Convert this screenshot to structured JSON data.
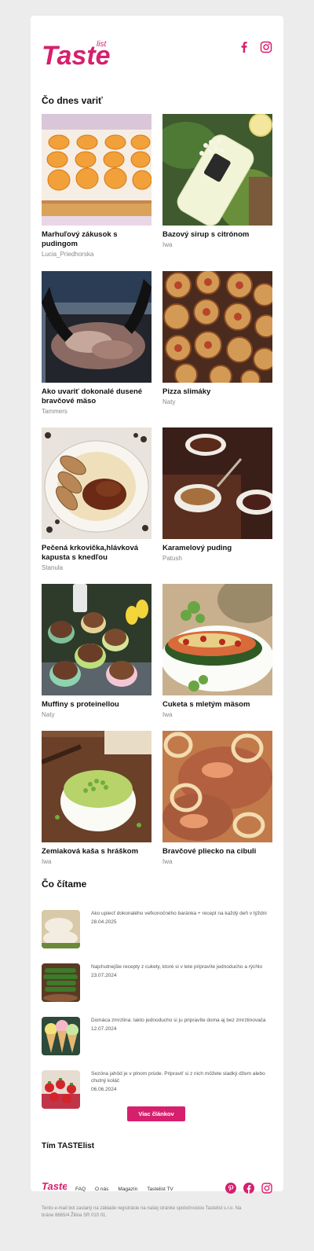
{
  "header": {
    "logo_text": "Taste",
    "logo_sub": "list"
  },
  "section_recipes": {
    "title": "Čo dnes variť"
  },
  "recipes": [
    {
      "title": "Marhuľový zákusok s pudingom",
      "author": "Lucia_Priedhorska"
    },
    {
      "title": "Bazový sirup s citrónom",
      "author": "Iwa"
    },
    {
      "title": "Ako uvariť dokonalé dusené bravčové mäso",
      "author": "Tammers"
    },
    {
      "title": "Pizza slimáky",
      "author": "Naty"
    },
    {
      "title": "Pečená krkovička,hlávková kapusta s knedľou",
      "author": "Stanula"
    },
    {
      "title": "Karamelový puding",
      "author": "Patush"
    },
    {
      "title": "Muffiny s proteinellou",
      "author": "Naty"
    },
    {
      "title": "Cuketa s mletým mäsom",
      "author": "Iwa"
    },
    {
      "title": "Zemiaková kaša s hráškom",
      "author": "Iwa"
    },
    {
      "title": "Bravčové pliecko na cibuli",
      "author": "Iwa"
    }
  ],
  "section_articles": {
    "title": "Čo čítame"
  },
  "articles": [
    {
      "title": "Ako upiecť dokonalého veľkonočného baránka + recept na každý deň v týždni",
      "date": "28.04.2025"
    },
    {
      "title": "Najchutnejšie recepty z cukety, ktoré si v lete pripravíte jednoducho a rýchlo",
      "date": "23.07.2024"
    },
    {
      "title": "Domáca zmrzlina: takto jednoducho si ju pripravíte doma aj bez zmrzlinovača",
      "date": "12.07.2024"
    },
    {
      "title": "Sezóna jahôd je v plnom prúde. Pripraviť si z nich môžete sladký džem alebo chutný koláč",
      "date": "06.06.2024"
    }
  ],
  "more_button": "Viac článkov",
  "signature": "Tím TASTElist",
  "footer": {
    "nav": [
      "FAQ",
      "O nás",
      "Magazín",
      "Tastelist TV"
    ],
    "legal": "Tento e-mail bol zaslaný na základe registrácie na našej stránke spoločnostou Tastelist s.r.o. Na bráne 8665/4 Žilina SR 010 01."
  },
  "colors": {
    "brand": "#d6206e",
    "page_bg": "#ececec",
    "card_bg": "#ffffff"
  },
  "icons": [
    "facebook-icon",
    "instagram-icon",
    "pinterest-icon"
  ]
}
